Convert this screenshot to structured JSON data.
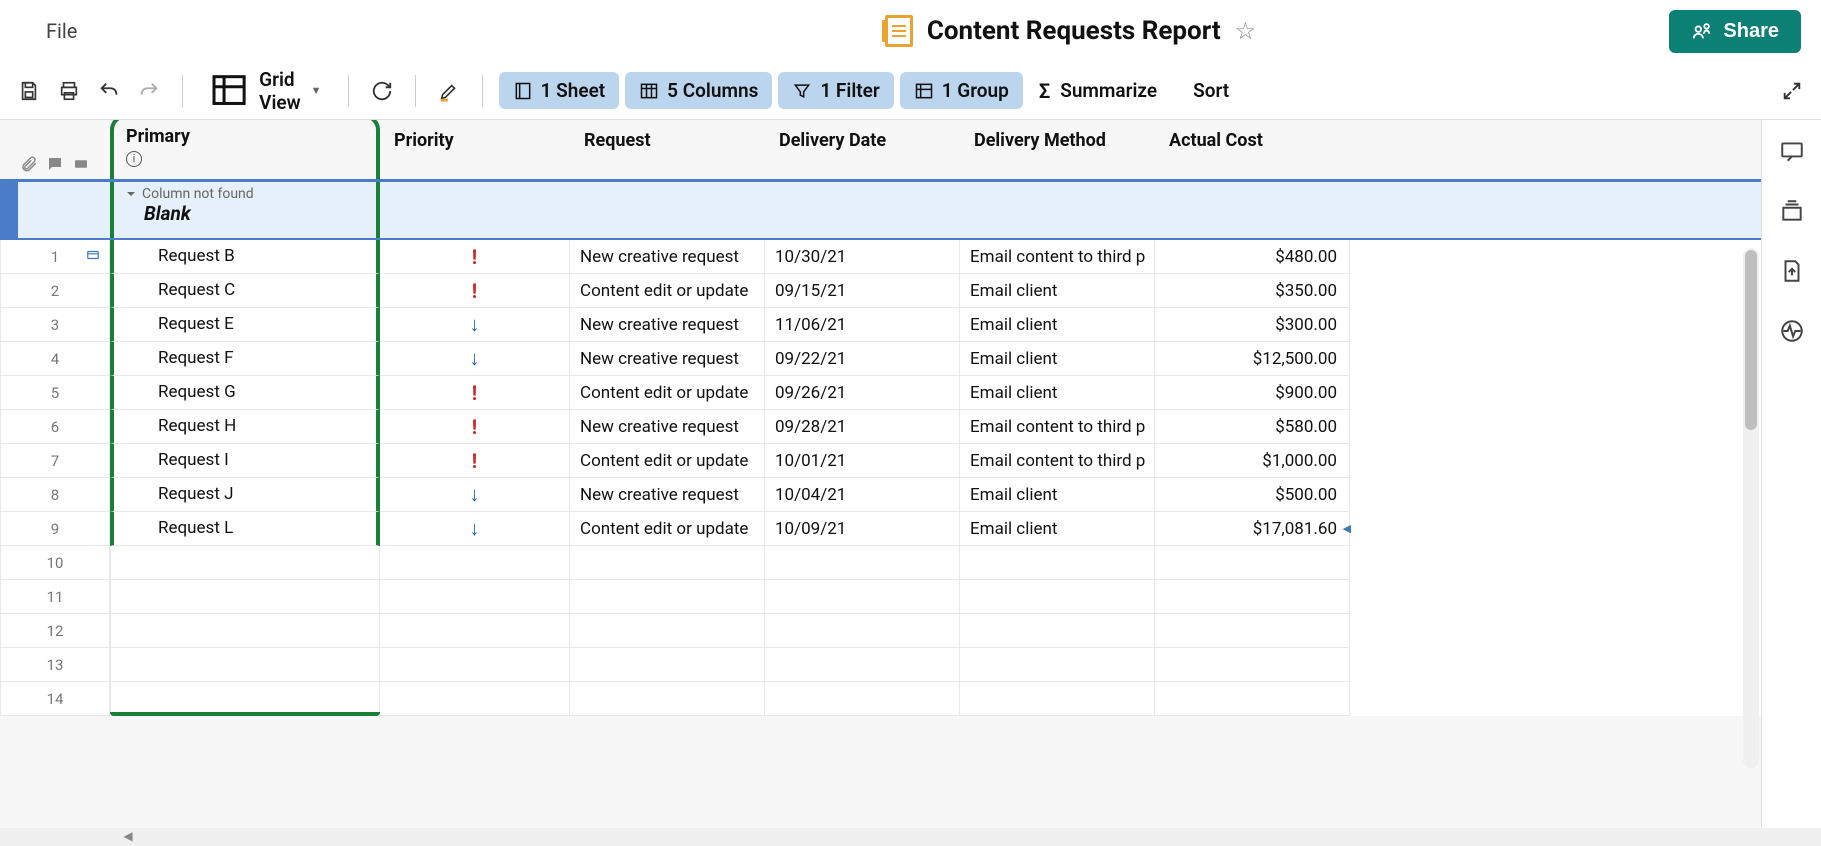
{
  "header": {
    "file_menu": "File",
    "title": "Content Requests Report",
    "share_label": "Share"
  },
  "toolbar": {
    "view_label": "Grid View",
    "sheet_label": "1 Sheet",
    "columns_label": "5 Columns",
    "filter_label": "1 Filter",
    "group_label": "1 Group",
    "summarize_label": "Summarize",
    "sort_label": "Sort"
  },
  "columns": {
    "primary": "Primary",
    "priority": "Priority",
    "request": "Request",
    "delivery_date": "Delivery Date",
    "delivery_method": "Delivery Method",
    "actual_cost": "Actual Cost"
  },
  "group": {
    "error": "Column not found",
    "value": "Blank"
  },
  "rows": [
    {
      "n": "1",
      "primary": "Request B",
      "priority": "high",
      "request": "New creative request",
      "date": "10/30/21",
      "method": "Email content to third p",
      "cost": "$480.00"
    },
    {
      "n": "2",
      "primary": "Request C",
      "priority": "high",
      "request": "Content edit or update",
      "date": "09/15/21",
      "method": "Email client",
      "cost": "$350.00"
    },
    {
      "n": "3",
      "primary": "Request E",
      "priority": "low",
      "request": "New creative request",
      "date": "11/06/21",
      "method": "Email client",
      "cost": "$300.00"
    },
    {
      "n": "4",
      "primary": "Request F",
      "priority": "low",
      "request": "New creative request",
      "date": "09/22/21",
      "method": "Email client",
      "cost": "$12,500.00"
    },
    {
      "n": "5",
      "primary": "Request G",
      "priority": "high",
      "request": "Content edit or update",
      "date": "09/26/21",
      "method": "Email client",
      "cost": "$900.00"
    },
    {
      "n": "6",
      "primary": "Request H",
      "priority": "high",
      "request": "New creative request",
      "date": "09/28/21",
      "method": "Email content to third p",
      "cost": "$580.00"
    },
    {
      "n": "7",
      "primary": "Request I",
      "priority": "high",
      "request": "Content edit or update",
      "date": "10/01/21",
      "method": "Email content to third p",
      "cost": "$1,000.00"
    },
    {
      "n": "8",
      "primary": "Request J",
      "priority": "low",
      "request": "New creative request",
      "date": "10/04/21",
      "method": "Email client",
      "cost": "$500.00"
    },
    {
      "n": "9",
      "primary": "Request L",
      "priority": "low",
      "request": "Content edit or update",
      "date": "10/09/21",
      "method": "Email client",
      "cost": "$17,081.60"
    }
  ],
  "empty_rows": [
    "10",
    "11",
    "12",
    "13",
    "14"
  ]
}
